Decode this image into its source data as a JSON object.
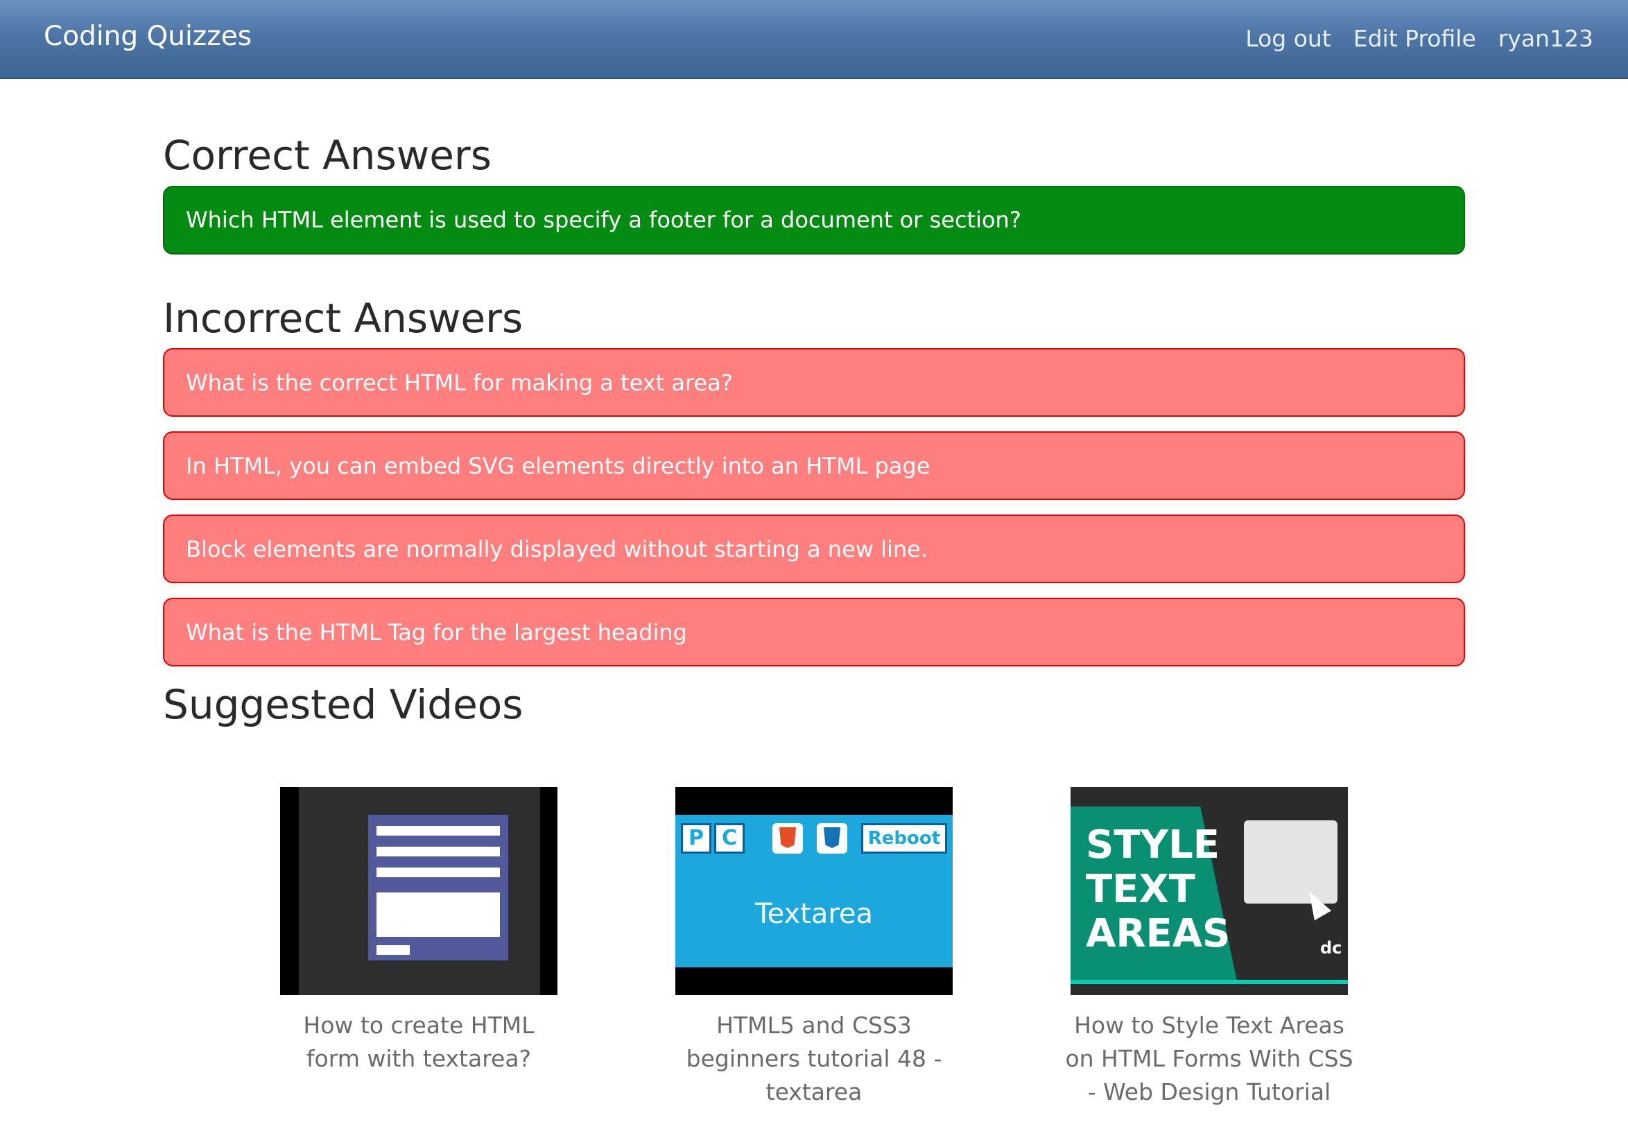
{
  "navbar": {
    "brand": "Coding Quizzes",
    "links": {
      "logout": "Log out",
      "edit_profile": "Edit Profile",
      "username": "ryan123"
    }
  },
  "correct_section": {
    "heading": "Correct Answers",
    "items": [
      "Which HTML element is used to specify a footer for a document or section?"
    ]
  },
  "incorrect_section": {
    "heading": "Incorrect Answers",
    "items": [
      "What is the correct HTML for making a text area?",
      "In HTML, you can embed SVG elements directly into an HTML page",
      "Block elements are normally displayed without starting a new line.",
      "What is the HTML Tag for the largest heading"
    ]
  },
  "videos_section": {
    "heading": "Suggested Videos",
    "videos": [
      {
        "title": "How to create HTML form with textarea?",
        "thumbnail": "html-form-screenshot"
      },
      {
        "title": "HTML5 and CSS3 beginners tutorial 48 - textarea",
        "thumbnail": "pc-html5-css3-reboot-textarea",
        "thumb_text": {
          "p": "P",
          "c": "C",
          "reboot": "Reboot",
          "title": "Textarea"
        }
      },
      {
        "title": "How to Style Text Areas on HTML Forms With CSS - Web Design Tutorial",
        "thumbnail": "style-text-areas",
        "thumb_text": {
          "line1": "STYLE",
          "line2": "TEXT",
          "line3": "AREAS",
          "logo": "dc"
        }
      }
    ]
  },
  "colors": {
    "navbar": "#4d76a6",
    "correct": "#038c11",
    "incorrect": "#ff7f7f",
    "incorrect_border": "#e60000"
  }
}
